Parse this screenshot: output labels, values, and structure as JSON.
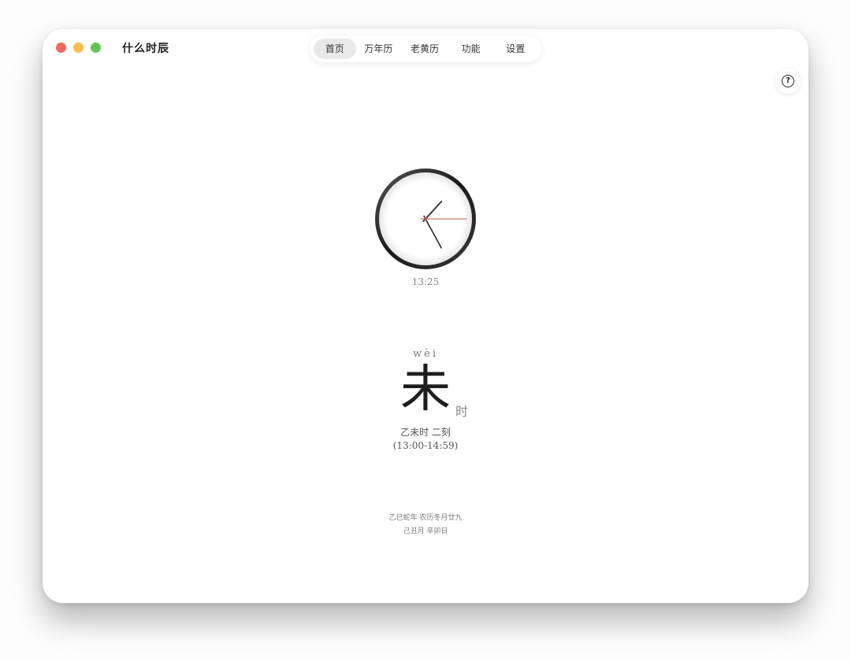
{
  "app": {
    "title": "什么时辰"
  },
  "tabs": [
    {
      "label": "首页",
      "active": true
    },
    {
      "label": "万年历",
      "active": false
    },
    {
      "label": "老黄历",
      "active": false
    },
    {
      "label": "功能",
      "active": false
    },
    {
      "label": "设置",
      "active": false
    }
  ],
  "help": {
    "glyph": "?",
    "icon": "question-circle-icon"
  },
  "clock": {
    "time_text": "13:25",
    "hour": 13,
    "minute": 25,
    "second": 15,
    "second_hand_color": "#b85a5a"
  },
  "shichen": {
    "pinyin": "wèi",
    "char": "未",
    "suffix": "时",
    "ke_text": "乙未时 二刻",
    "range_text": "(13:00-14:59)"
  },
  "lunar": {
    "line1": "乙巳蛇年 农历冬月廿九",
    "line2": "己丑月 辛卯日"
  },
  "colors": {
    "traffic_close": "#ee6a5f",
    "traffic_min": "#f5be4f",
    "traffic_max": "#62c554",
    "active_tab_bg": "#e9e9e9"
  }
}
